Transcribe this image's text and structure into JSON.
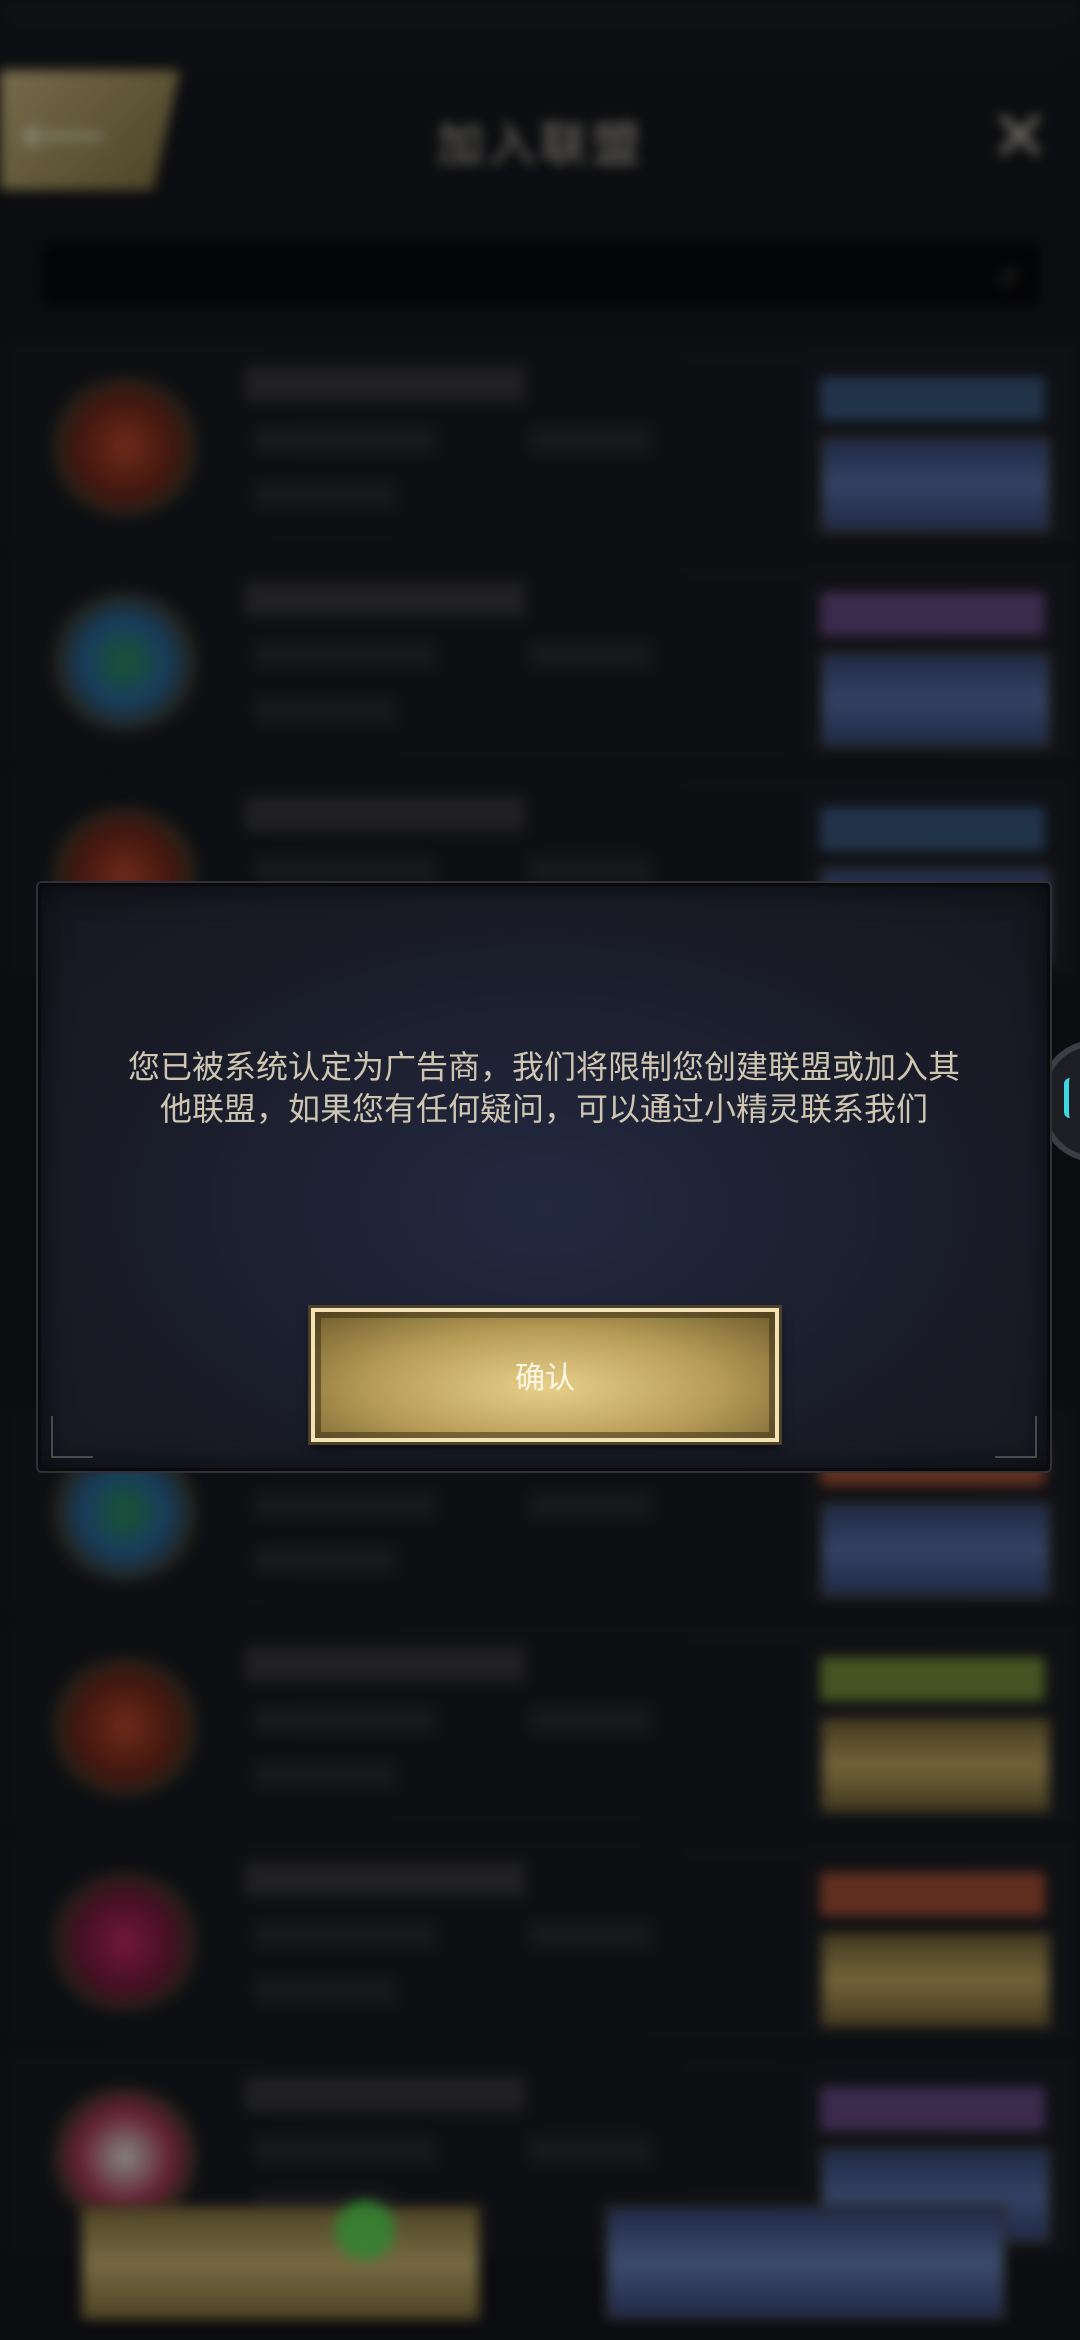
{
  "header": {
    "title": "加入联盟",
    "back_icon": "back-arrow-icon",
    "close_icon": "close-icon"
  },
  "search": {
    "icon": "search-icon"
  },
  "dialog": {
    "message": "您已被系统认定为广告商，我们将限制您创建联盟或加入其他联盟，如果您有任何疑问，可以通过小精灵联系我们",
    "confirm_label": "确认"
  },
  "colors": {
    "dialog_text": "#cfc6b2",
    "confirm_gold": "#e8d08a",
    "accent_cyan": "#3fd8e0"
  }
}
